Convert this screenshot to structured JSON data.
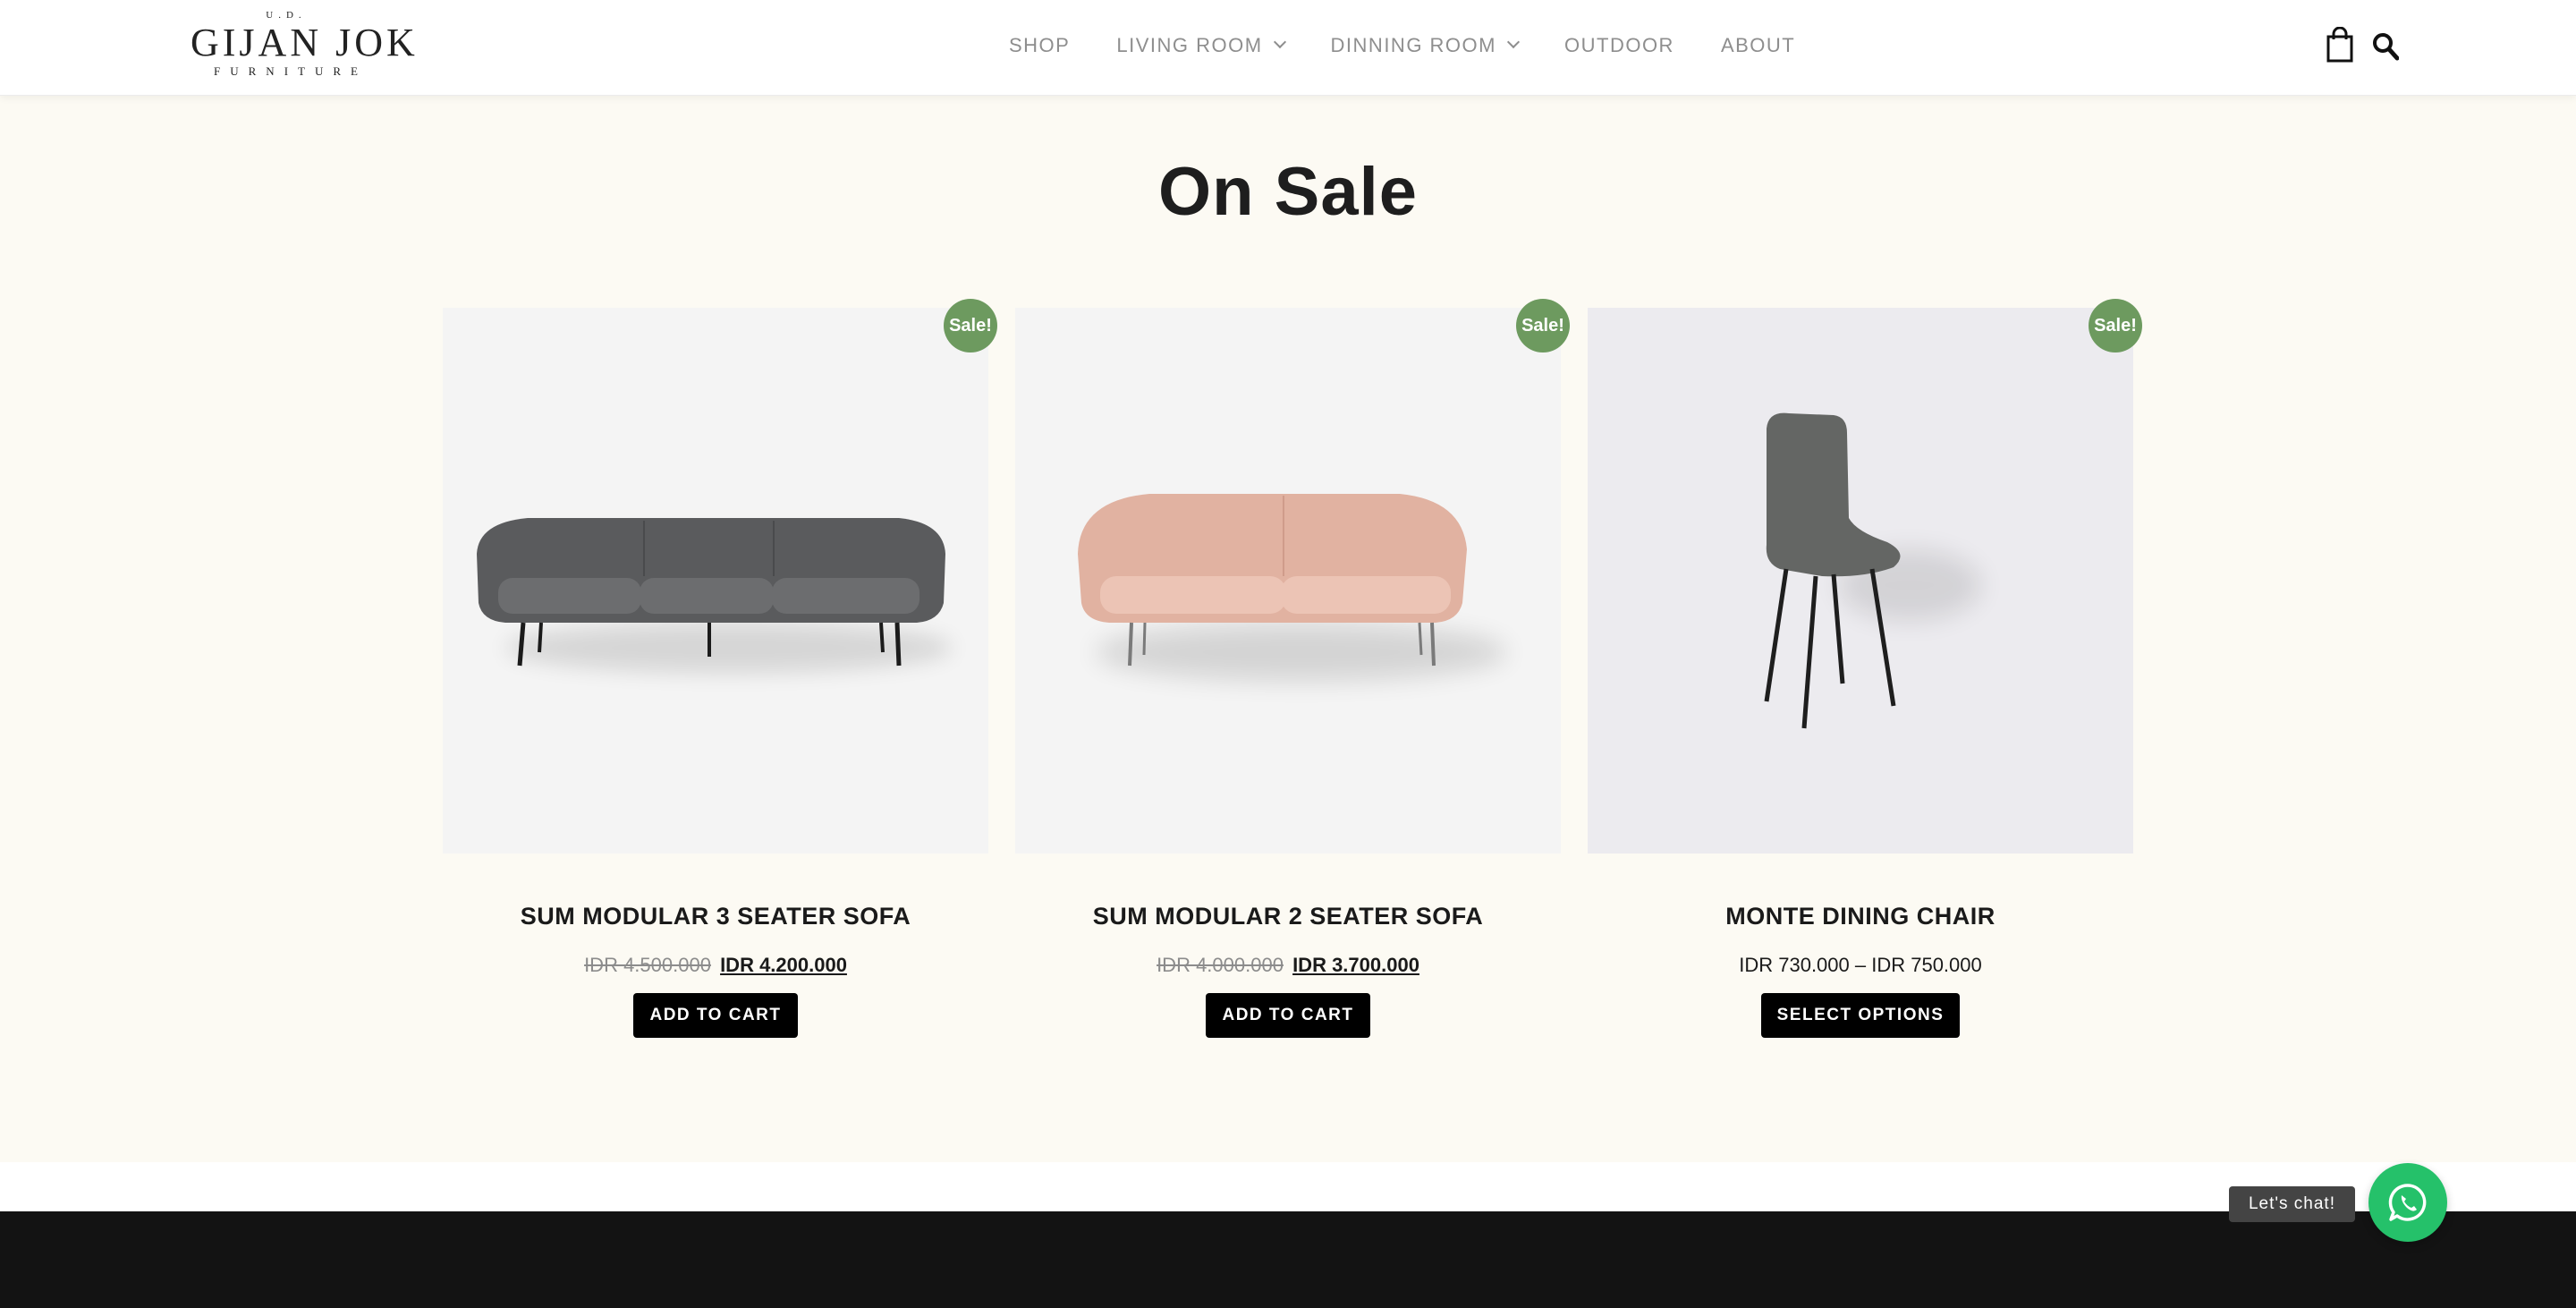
{
  "header": {
    "logo": {
      "top": "U.D.",
      "main": "GIJAN JOK",
      "sub": "FURNITURE"
    },
    "nav": [
      {
        "label": "SHOP",
        "dropdown": false
      },
      {
        "label": "LIVING ROOM",
        "dropdown": true
      },
      {
        "label": "DINNING ROOM",
        "dropdown": true
      },
      {
        "label": "OUTDOOR",
        "dropdown": false
      },
      {
        "label": "ABOUT",
        "dropdown": false
      }
    ],
    "icons": {
      "cart": "shopping-bag-icon",
      "search": "search-icon"
    }
  },
  "sale": {
    "title": "On Sale",
    "badge": "Sale!",
    "products": [
      {
        "name": "SUM MODULAR 3 SEATER SOFA",
        "price_old": "IDR 4.500.000",
        "price_new": "IDR 4.200.000",
        "button": "ADD TO CART",
        "image": "grey-3-seater-sofa"
      },
      {
        "name": "SUM MODULAR 2 SEATER SOFA",
        "price_old": "IDR 4.000.000",
        "price_new": "IDR 3.700.000",
        "button": "ADD TO CART",
        "image": "pink-2-seater-sofa"
      },
      {
        "name": "MONTE DINING CHAIR",
        "price_range": "IDR 730.000 – IDR 750.000",
        "button": "SELECT OPTIONS",
        "image": "grey-dining-chair"
      }
    ]
  },
  "chat": {
    "label": "Let's chat!",
    "icon": "whatsapp-icon"
  },
  "colors": {
    "section_bg": "#fcfaf3",
    "badge": "#6d9a5f",
    "button": "#000000",
    "chat": "#25c16a",
    "footer": "#131313"
  }
}
